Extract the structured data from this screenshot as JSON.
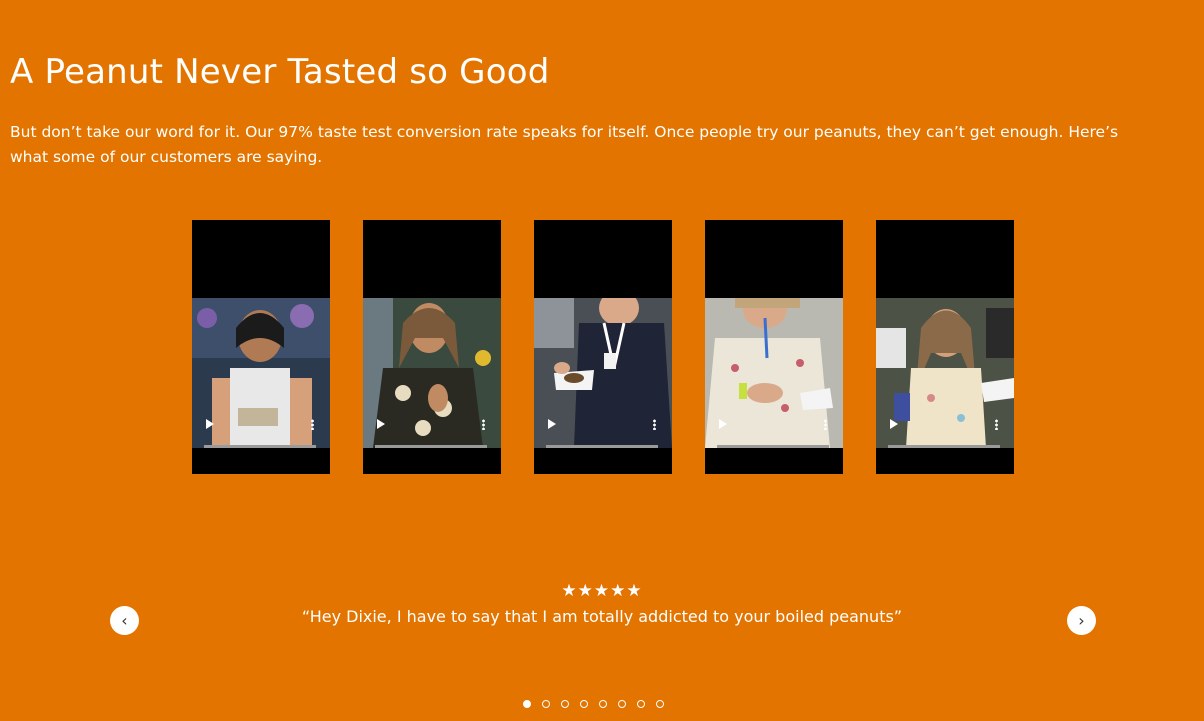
{
  "section": {
    "title": "A Peanut Never Tasted so Good",
    "intro": "But don’t take our word for it. Our 97% taste test conversion rate speaks for itself. Once people try our peanuts, they can’t get enough. Here’s what some of our customers are saying."
  },
  "videos": [
    {
      "progress": 0
    },
    {
      "progress": 0
    },
    {
      "progress": 0
    },
    {
      "progress": 0
    },
    {
      "progress": 0
    }
  ],
  "testimonial": {
    "stars": "★★★★★",
    "rating": 5,
    "quote": "“Hey Dixie, I have to say that I am totally addicted to your boiled peanuts”"
  },
  "carousel": {
    "prev_icon": "chevron-left-icon",
    "next_icon": "chevron-right-icon",
    "page_count": 8,
    "active_index": 0
  },
  "colors": {
    "background": "#E37400",
    "text": "#FFFFFF"
  }
}
